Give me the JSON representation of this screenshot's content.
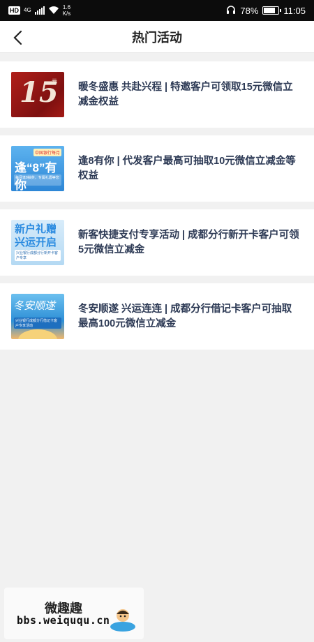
{
  "status_bar": {
    "hd": "HD",
    "network": "4G",
    "speed_value": "1.6",
    "speed_unit": "K/s",
    "battery_text": "78%",
    "battery_level": 0.78,
    "time": "11:05"
  },
  "nav": {
    "title": "热门活动"
  },
  "activities": [
    {
      "text": "暖冬盛惠 共赴兴程 | 特邀客户可领取15元微信立减金权益",
      "thumb": {
        "big": "15",
        "unit": "元"
      }
    },
    {
      "text": "逢8有你 | 代发客户最高可抽取10元微信立减金等权益",
      "thumb": {
        "tag": "中国银行每月",
        "big": "逢“8”有你",
        "sub": "每月逢8抽奖，专属礼遇等您来"
      }
    },
    {
      "text": "新客快捷支付专享活动 | 成都分行新开卡客户可领5元微信立减金",
      "thumb": {
        "big_line1": "新户礼赠",
        "big_line2": "兴运开启",
        "sub": "兴业银行成都分行新开卡客户专享"
      }
    },
    {
      "text": "冬安顺遂 兴运连连 | 成都分行借记卡客户可抽取最高100元微信立减金",
      "thumb": {
        "big": "冬安顺遂",
        "sub": "兴业银行成都分行借记卡客户专享活动"
      }
    }
  ],
  "watermark": {
    "title": "微趣趣",
    "url": "bbs.weiququ.cn"
  }
}
